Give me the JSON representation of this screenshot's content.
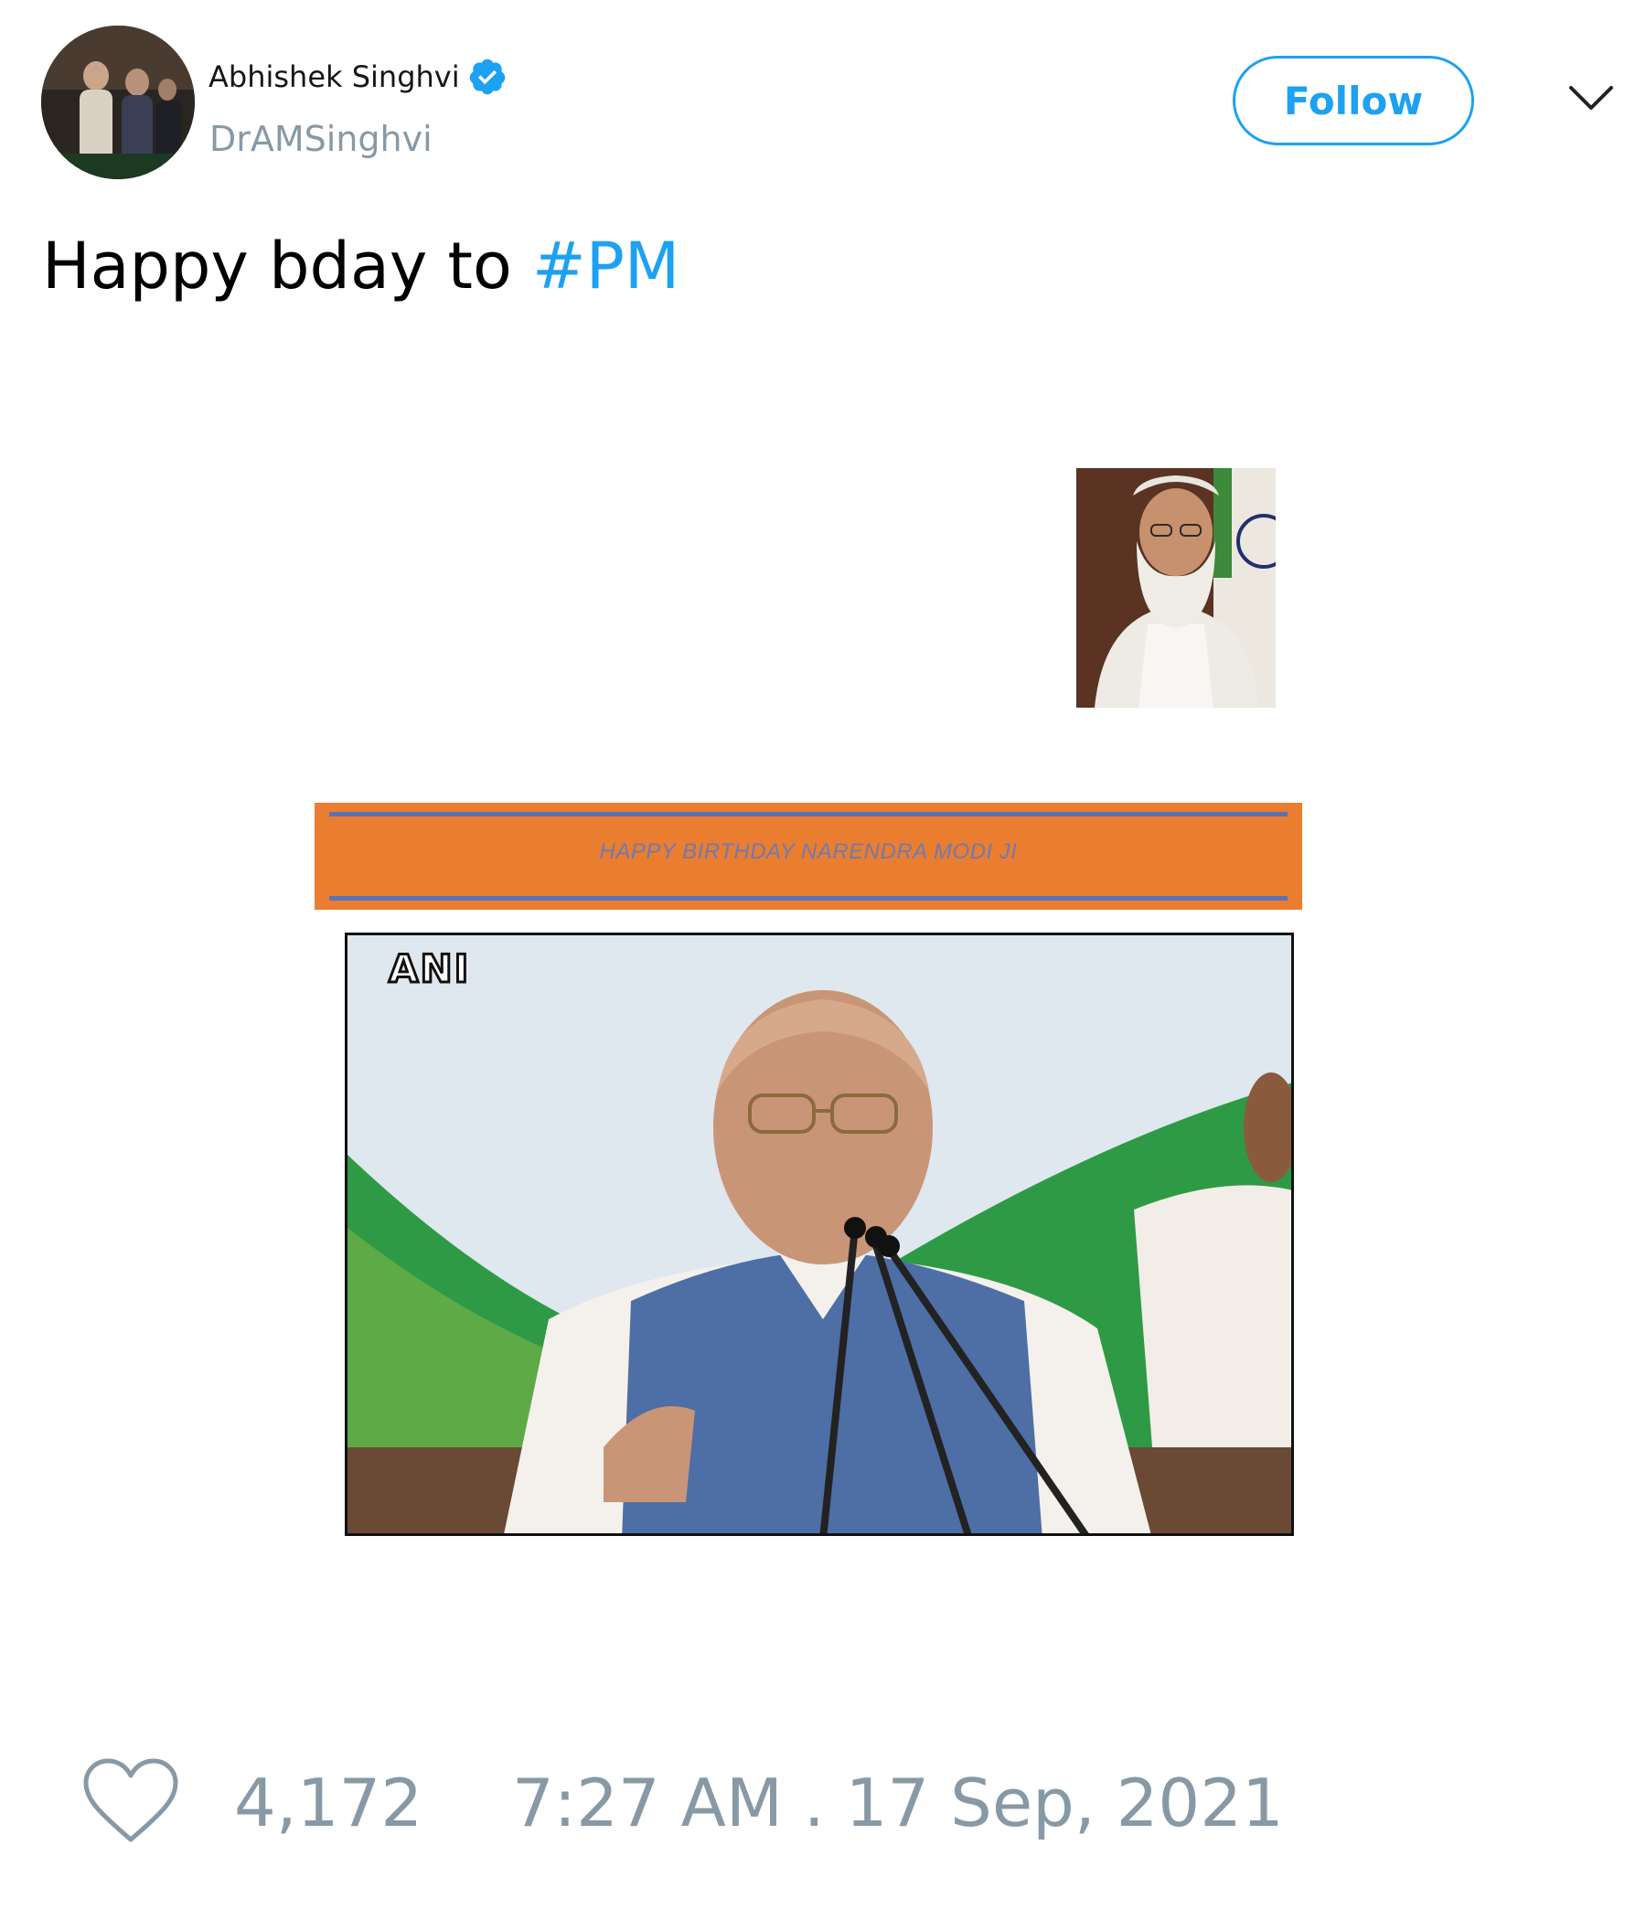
{
  "author": {
    "display_name": "Abhishek Singhvi",
    "handle": "DrAMSinghvi",
    "verified": true
  },
  "follow_button": {
    "label": "Follow"
  },
  "tweet": {
    "text_prefix": "Happy bday to ",
    "hashtag": "#PM"
  },
  "media": {
    "banner_text": "HAPPY BIRTHDAY NARENDRA MODI JI",
    "watermark": "ANI"
  },
  "footer": {
    "like_count": "4,172",
    "timestamp": "7:27 AM . 17 Sep, 2021"
  },
  "colors": {
    "accent": "#1da1f2",
    "muted": "#8899a6",
    "banner": "#ea7d2f",
    "banner_line": "#5a72b6"
  },
  "icons": {
    "verified": "verified-badge-icon",
    "more": "chevron-down-icon",
    "like": "heart-icon"
  }
}
